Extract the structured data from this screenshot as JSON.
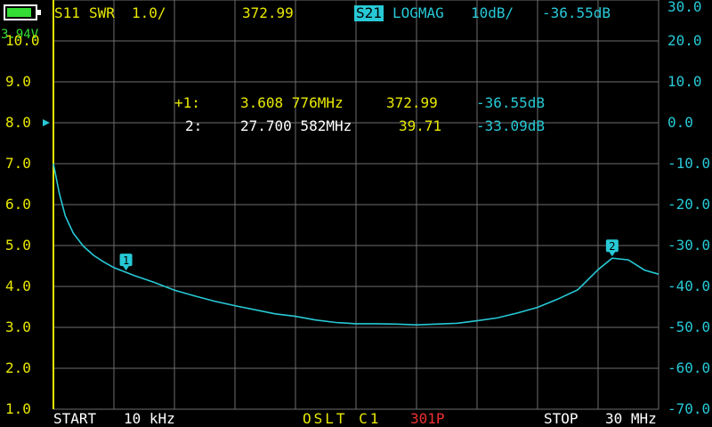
{
  "battery": {
    "voltage": "3.94V",
    "level": 0.9,
    "color": "#33dd33"
  },
  "header": {
    "trace1": {
      "label": "S11",
      "format": "SWR",
      "scale": "1.0/",
      "value": "372.99",
      "color": "#e8e800"
    },
    "trace2": {
      "label": "S21",
      "format": "LOGMAG",
      "scale": "10dB/",
      "value": "-36.55dB",
      "color": "#27c9d6"
    }
  },
  "markers": {
    "rows": [
      {
        "id": "+1:",
        "freq": "3.608 776MHz",
        "swr": "372.99",
        "logmag": "-36.55dB",
        "active": true
      },
      {
        "id": "2:",
        "freq": "27.700 582MHz",
        "swr": "39.71",
        "logmag": "-33.09dB",
        "active": false
      }
    ],
    "labels": [
      "1",
      "2"
    ]
  },
  "left_axis": {
    "labels": [
      "10.0",
      "9.0",
      "8.0",
      "7.0",
      "6.0",
      "5.0",
      "4.0",
      "3.0",
      "2.0",
      "1.0"
    ],
    "color": "#e8e800"
  },
  "right_axis": {
    "labels": [
      "30.0",
      "20.0",
      "10.0",
      "0.0",
      "-10.0",
      "-20.0",
      "-30.0",
      "-40.0",
      "-50.0",
      "-60.0",
      "-70.0"
    ],
    "color": "#27c9d6"
  },
  "footer": {
    "start_label": "START",
    "start_value": "10 kHz",
    "cal": "OSLT C1",
    "points": "301P",
    "stop_label": "STOP",
    "stop_value": "30 MHz",
    "cal_color": "#e8e800",
    "points_color": "#ee3030"
  },
  "chart_data": {
    "type": "line",
    "x_unit": "MHz",
    "xlim": [
      0.01,
      30
    ],
    "series": [
      {
        "name": "S21",
        "axis": "right",
        "x": [
          0.01,
          0.3,
          0.6,
          1,
          1.5,
          2,
          2.5,
          3,
          3.608,
          4,
          5,
          6,
          7,
          8,
          9,
          10,
          11,
          12,
          13,
          14,
          15,
          16,
          17,
          18,
          19,
          20,
          21,
          22,
          23,
          24,
          25,
          26,
          27,
          27.7,
          28.5,
          29.3,
          30
        ],
        "y": [
          -10,
          -17.2,
          -22.8,
          -27.0,
          -30.2,
          -32.4,
          -34.0,
          -35.4,
          -36.55,
          -37.3,
          -39.0,
          -40.9,
          -42.3,
          -43.6,
          -44.7,
          -45.7,
          -46.7,
          -47.3,
          -48.2,
          -48.8,
          -49.1,
          -49.1,
          -49.2,
          -49.4,
          -49.2,
          -49.0,
          -48.4,
          -47.7,
          -46.5,
          -45.1,
          -43.1,
          -40.8,
          -35.9,
          -33.09,
          -33.5,
          -36.0,
          -37.0
        ]
      }
    ],
    "left_ylim": [
      1,
      10
    ],
    "right_ylim": [
      -70,
      30
    ],
    "grid": true
  }
}
